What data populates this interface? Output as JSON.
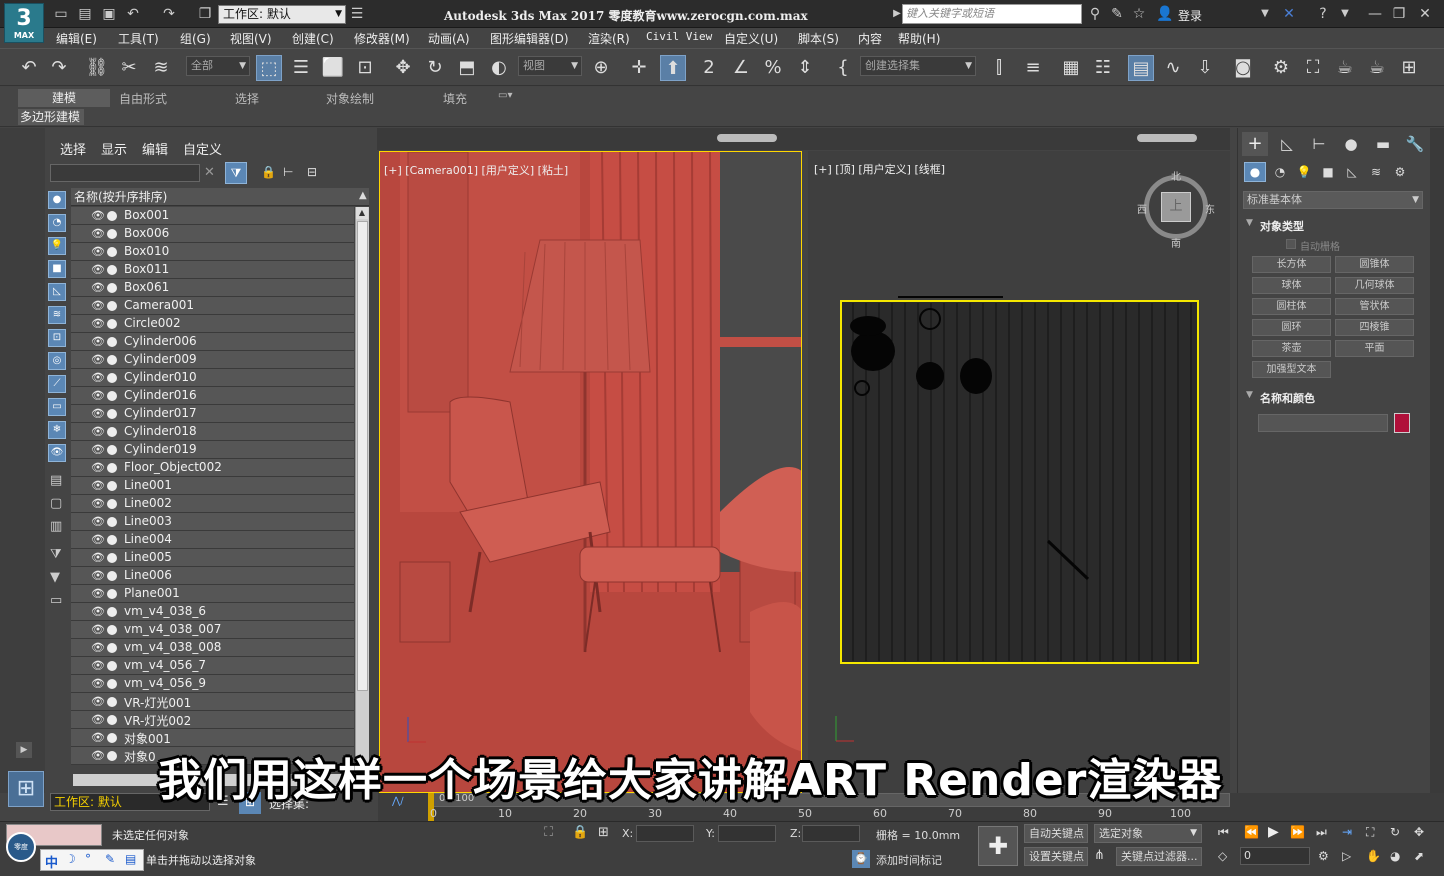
{
  "titlebar": {
    "logo_main": "3",
    "logo_sub": "MAX",
    "workspace_value": "工作区: 默认",
    "title": "Autodesk 3ds Max 2017     零度教育www.zerocgn.com.max",
    "search_placeholder": "键入关键字或短语",
    "login_label": "登录"
  },
  "menubar": {
    "items": [
      "编辑(E)",
      "工具(T)",
      "组(G)",
      "视图(V)",
      "创建(C)",
      "修改器(M)",
      "动画(A)",
      "图形编辑器(D)",
      "渲染(R)",
      "Civil View",
      "自定义(U)",
      "脚本(S)",
      "内容",
      "帮助(H)"
    ]
  },
  "toolbar": {
    "selection_filter": "全部",
    "ref_coord": "视图",
    "named_selection": "创建选择集"
  },
  "ribbon": {
    "tabs": [
      "建模",
      "自由形式",
      "选择",
      "对象绘制",
      "填充"
    ],
    "sub_label": "多边形建模"
  },
  "scene_explorer": {
    "tabs": [
      "选择",
      "显示",
      "编辑",
      "自定义"
    ],
    "column_header": "名称(按升序排序)",
    "items": [
      "Box001",
      "Box006",
      "Box010",
      "Box011",
      "Box061",
      "Camera001",
      "Circle002",
      "Cylinder006",
      "Cylinder009",
      "Cylinder010",
      "Cylinder016",
      "Cylinder017",
      "Cylinder018",
      "Cylinder019",
      "Floor_Object002",
      "Line001",
      "Line002",
      "Line003",
      "Line004",
      "Line005",
      "Line006",
      "Plane001",
      "vm_v4_038_6",
      "vm_v4_038_007",
      "vm_v4_038_008",
      "vm_v4_056_7",
      "vm_v4_056_9",
      "VR-灯光001",
      "VR-灯光002",
      "对象001",
      "对象0"
    ],
    "workspace_footer": "工作区: 默认",
    "selection_set_label": "选择集:"
  },
  "viewports": {
    "left_label": "[+] [Camera001] [用户定义] [粘土]",
    "right_label": "[+] [顶] [用户定义] [线框]",
    "viewcube_top": "北",
    "viewcube_left": "西",
    "viewcube_right": "东",
    "viewcube_bottom": "南",
    "viewcube_face": "上"
  },
  "command_panel": {
    "category_dropdown": "标准基本体",
    "object_type_title": "对象类型",
    "autogrid_label": "自动栅格",
    "buttons": [
      "长方体",
      "圆锥体",
      "球体",
      "几何球体",
      "圆柱体",
      "管状体",
      "圆环",
      "四棱锥",
      "茶壶",
      "平面",
      "加强型文本"
    ],
    "name_color_title": "名称和颜色",
    "color_swatch": "#b0103a"
  },
  "timeline": {
    "frame_display": "0 / 100",
    "ticks": [
      "0",
      "10",
      "20",
      "30",
      "40",
      "50",
      "60",
      "70",
      "80",
      "90",
      "100"
    ]
  },
  "status": {
    "line1": "未选定任何对象",
    "line2": "单击并拖动以选择对象",
    "x_label": "X:",
    "y_label": "Y:",
    "z_label": "Z:",
    "grid_text": "栅格 = 10.0mm",
    "add_time_tag": "添加时间标记",
    "auto_key": "自动关键点",
    "set_key": "设置关键点",
    "selected_object": "选定对象",
    "key_filters": "关键点过滤器...",
    "frame_value": "0",
    "ime_label": "中"
  },
  "subtitle": "我们用这样一个场景给大家讲解ART Render渲染器"
}
